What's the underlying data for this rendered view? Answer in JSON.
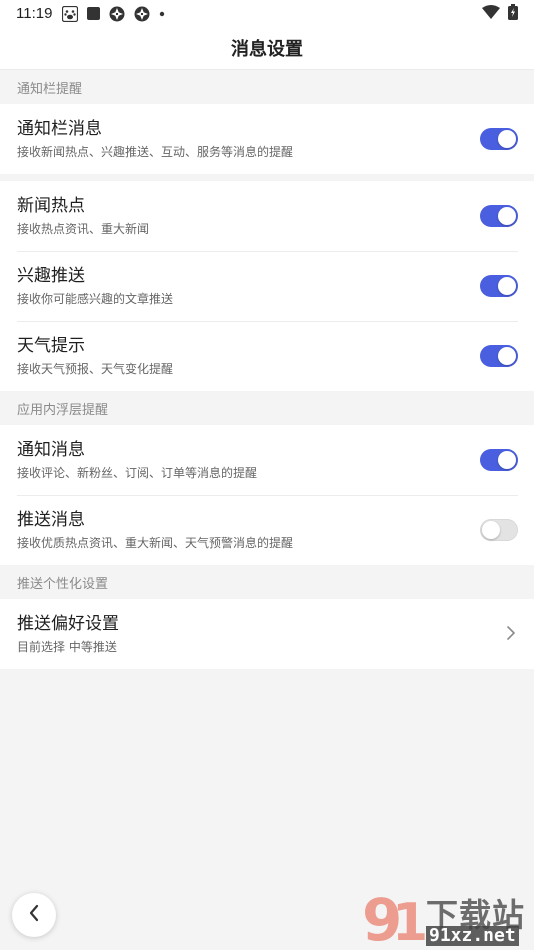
{
  "status_bar": {
    "time": "11:19",
    "icons": [
      "paw-icon",
      "square-icon",
      "aperture-icon",
      "aperture-icon",
      "dot-icon"
    ],
    "right_icons": [
      "wifi-icon",
      "battery-icon"
    ]
  },
  "header": {
    "title": "消息设置"
  },
  "sections": [
    {
      "header": "通知栏提醒"
    },
    {
      "header": "应用内浮层提醒"
    },
    {
      "header": "推送个性化设置"
    }
  ],
  "rows": {
    "notify_bar": {
      "title": "通知栏消息",
      "desc": "接收新闻热点、兴趣推送、互动、服务等消息的提醒",
      "enabled": true
    },
    "news_hot": {
      "title": "新闻热点",
      "desc": "接收热点资讯、重大新闻",
      "enabled": true
    },
    "interest_push": {
      "title": "兴趣推送",
      "desc": "接收你可能感兴趣的文章推送",
      "enabled": true
    },
    "weather": {
      "title": "天气提示",
      "desc": "接收天气预报、天气变化提醒",
      "enabled": true
    },
    "notify_msg": {
      "title": "通知消息",
      "desc": "接收评论、新粉丝、订阅、订单等消息的提醒",
      "enabled": true
    },
    "push_msg": {
      "title": "推送消息",
      "desc": "接收优质热点资讯、重大新闻、天气预警消息的提醒",
      "enabled": false
    },
    "push_pref": {
      "title": "推送偏好设置",
      "desc": "目前选择 中等推送"
    }
  },
  "colors": {
    "accent": "#4a5fe0",
    "toggle_off": "#e3e3e3",
    "background": "#f4f4f4"
  },
  "watermark": {
    "text": "91xz.net",
    "label": "下载站"
  }
}
